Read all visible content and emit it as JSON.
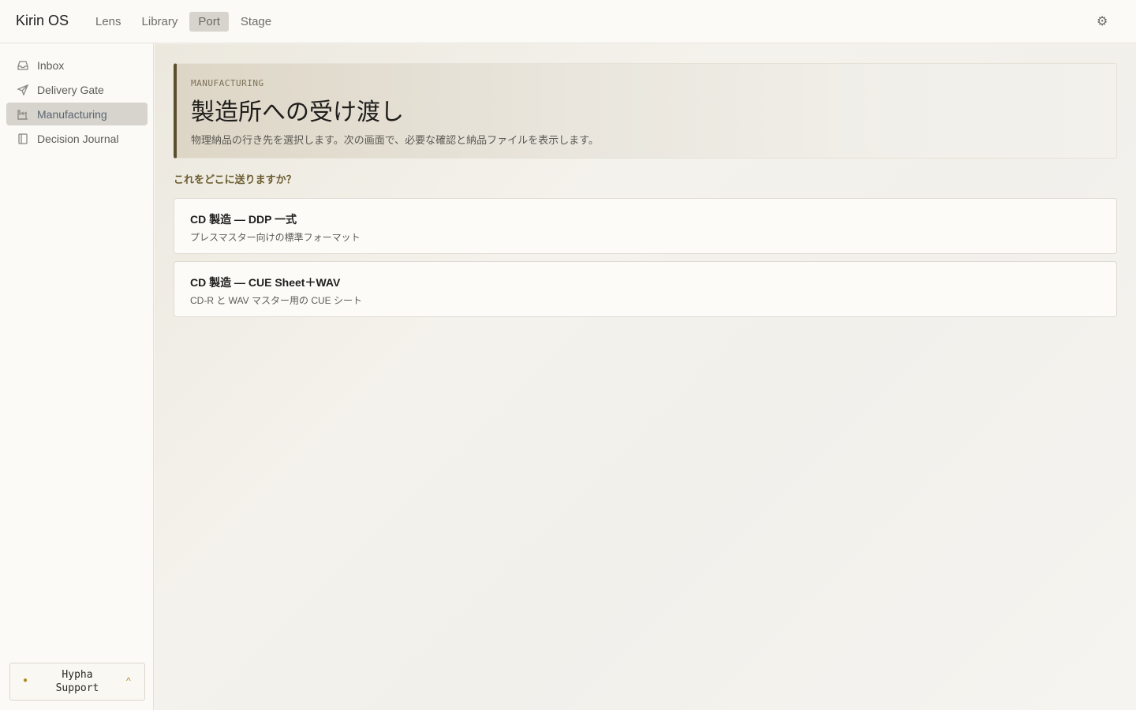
{
  "app": {
    "title": "Kirin OS"
  },
  "nav": {
    "tabs": [
      {
        "label": "Lens"
      },
      {
        "label": "Library"
      },
      {
        "label": "Port",
        "active": true
      },
      {
        "label": "Stage"
      }
    ]
  },
  "header": {
    "settings_icon": "gear-icon",
    "settings_glyph": "⚙"
  },
  "sidebar": {
    "items": [
      {
        "label": "Inbox",
        "icon": "inbox-icon"
      },
      {
        "label": "Delivery Gate",
        "icon": "send-icon"
      },
      {
        "label": "Manufacturing",
        "icon": "factory-icon",
        "active": true
      },
      {
        "label": "Decision Journal",
        "icon": "notebook-icon"
      }
    ],
    "support": {
      "status_glyph": "●",
      "name": "Hypha Support",
      "caret": "^",
      "status_color": "#b08a20"
    }
  },
  "main": {
    "eyebrow": "MANUFACTURING",
    "title": "製造所への受け渡し",
    "description": "物理納品の行き先を選択します。次の画面で、必要な確認と納品ファイルを表示します。",
    "question": "これをどこに送りますか？",
    "options": [
      {
        "title": "CD 製造 — DDP 一式",
        "subtitle": "プレスマスター向けの標準フォーマット"
      },
      {
        "title": "CD 製造 — CUE Sheet＋WAV",
        "subtitle": "CD-R と WAV マスター用の CUE シート"
      }
    ]
  },
  "colors": {
    "accent": "#5b4e2c",
    "active_bg": "#d7d4cd",
    "question": "#6b5c2e"
  }
}
